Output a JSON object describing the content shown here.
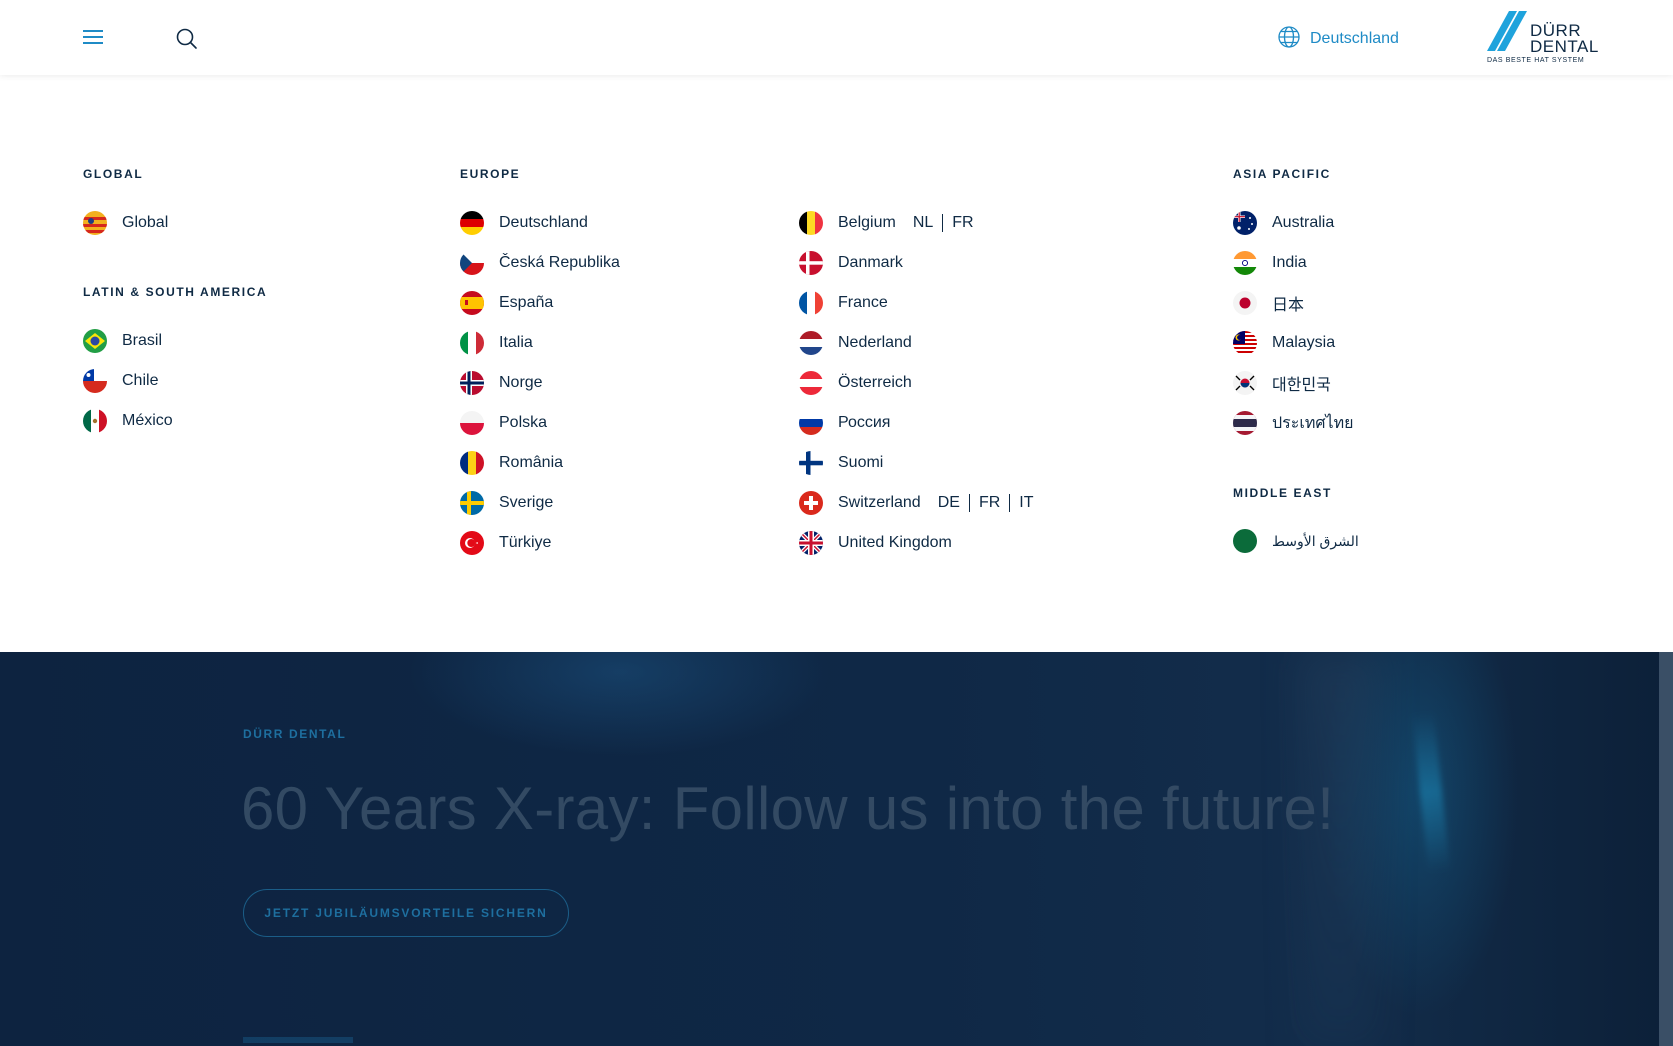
{
  "header": {
    "menu_icon": "hamburger-icon",
    "search_icon": "search-icon",
    "language": {
      "icon": "globe-icon",
      "label": "Deutschland"
    },
    "logo": {
      "line1": "DÜRR",
      "line2": "DENTAL",
      "slogan": "DAS BESTE HAT SYSTEM"
    }
  },
  "colors": {
    "accent": "#1f8bc6",
    "navy": "#0f2a44",
    "hero_bg": "#0f2846"
  },
  "regions": {
    "global": {
      "heading": "GLOBAL",
      "countries": [
        {
          "name": "Global"
        }
      ]
    },
    "latam": {
      "heading": "LATIN & SOUTH AMERICA",
      "countries": [
        {
          "name": "Brasil"
        },
        {
          "name": "Chile"
        },
        {
          "name": "México"
        }
      ]
    },
    "europe": {
      "heading": "EUROPE",
      "col1": [
        {
          "name": "Deutschland"
        },
        {
          "name": "Česká Republika"
        },
        {
          "name": "España"
        },
        {
          "name": "Italia"
        },
        {
          "name": "Norge"
        },
        {
          "name": "Polska"
        },
        {
          "name": "România"
        },
        {
          "name": "Sverige"
        },
        {
          "name": "Türkiye"
        }
      ],
      "col2": [
        {
          "name": "Belgium",
          "sub": [
            "NL",
            "FR"
          ]
        },
        {
          "name": "Danmark"
        },
        {
          "name": "France"
        },
        {
          "name": "Nederland"
        },
        {
          "name": "Österreich"
        },
        {
          "name": "Россия"
        },
        {
          "name": "Suomi"
        },
        {
          "name": "Switzerland",
          "sub": [
            "DE",
            "FR",
            "IT"
          ]
        },
        {
          "name": "United Kingdom"
        }
      ]
    },
    "apac": {
      "heading": "ASIA PACIFIC",
      "countries": [
        {
          "name": "Australia"
        },
        {
          "name": "India"
        },
        {
          "name": "日本"
        },
        {
          "name": "Malaysia"
        },
        {
          "name": "대한민국"
        },
        {
          "name": "ประเทศไทย"
        }
      ]
    },
    "middle_east": {
      "heading": "MIDDLE EAST",
      "countries": [
        {
          "name": "الشرق الأوسط"
        }
      ]
    }
  },
  "hero": {
    "eyebrow": "DÜRR DENTAL",
    "title": "60 Years X-ray: Follow us into the future!",
    "cta_label": "JETZT JUBILÄUMSVORTEILE SICHERN"
  }
}
